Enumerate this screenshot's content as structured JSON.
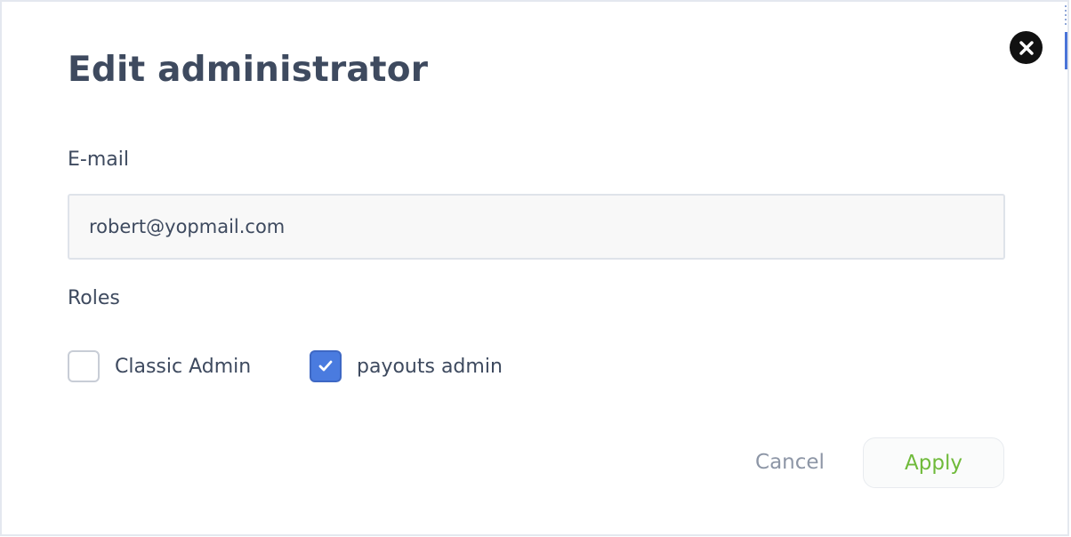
{
  "dialog": {
    "title": "Edit administrator",
    "close_icon": "close-icon"
  },
  "email": {
    "label": "E-mail",
    "value": "robert@yopmail.com",
    "placeholder": ""
  },
  "roles": {
    "label": "Roles",
    "items": [
      {
        "label": "Classic Admin",
        "checked": false
      },
      {
        "label": "payouts admin",
        "checked": true
      }
    ]
  },
  "actions": {
    "cancel_label": "Cancel",
    "apply_label": "Apply"
  },
  "colors": {
    "text": "#3e4a5f",
    "checkbox_accent": "#4a7bdf",
    "apply_text": "#6fba3a",
    "cancel_text": "#8d96a6"
  }
}
